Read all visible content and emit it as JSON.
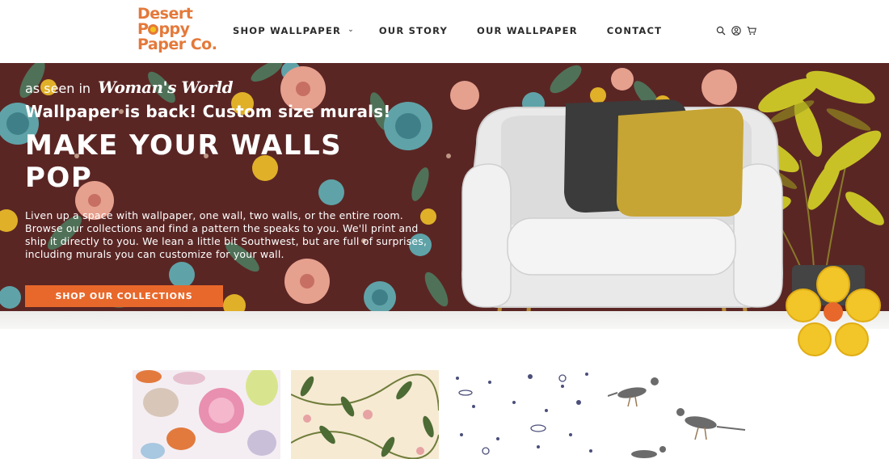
{
  "brand": {
    "logo_line1": "Desert",
    "logo_line2_a": "P",
    "logo_line2_b": "ppy",
    "logo_line3": "Paper Co.",
    "accent_color": "#e4793a"
  },
  "nav": {
    "items": [
      {
        "label": "SHOP WALLPAPER",
        "has_dropdown": true
      },
      {
        "label": "OUR STORY"
      },
      {
        "label": "OUR WALLPAPER"
      },
      {
        "label": "CONTACT"
      }
    ]
  },
  "header_icons": [
    "search-icon",
    "account-icon",
    "cart-icon"
  ],
  "hero": {
    "as_seen_in": "as seen in",
    "magazine": "Woman's World",
    "tagline": "Wallpaper is back! Custom size murals!",
    "headline": "MAKE YOUR WALLS POP",
    "body": "Liven up a space with wallpaper, one wall, two walls, or the entire room. Browse our collections and find a pattern the speaks to you. We'll print and ship it directly to you. We lean a little bit Southwest, but are full of surprises, including murals you can customize for your wall.",
    "cta_label": "SHOP OUR COLLECTIONS",
    "cta_color": "#e8682b",
    "background_color": "#5a2624"
  },
  "swatches": [
    {
      "name": "seashells"
    },
    {
      "name": "vines-floral"
    },
    {
      "name": "space-galaxies"
    },
    {
      "name": "roadrunners"
    }
  ]
}
